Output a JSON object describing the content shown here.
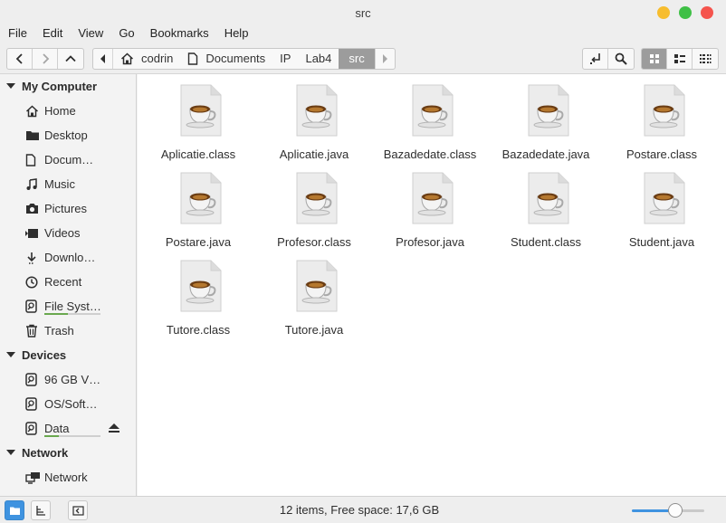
{
  "window": {
    "title": "src"
  },
  "menu": [
    "File",
    "Edit",
    "View",
    "Go",
    "Bookmarks",
    "Help"
  ],
  "breadcrumbs": [
    {
      "label": "codrin",
      "icon": "home-icon"
    },
    {
      "label": "Documents",
      "icon": "document-icon"
    },
    {
      "label": "IP"
    },
    {
      "label": "Lab4"
    },
    {
      "label": "src",
      "active": true
    }
  ],
  "sidebar": {
    "sections": [
      {
        "title": "My Computer",
        "items": [
          {
            "label": "Home",
            "icon": "home-icon"
          },
          {
            "label": "Desktop",
            "icon": "folder-icon"
          },
          {
            "label": "Docum…",
            "icon": "document-icon"
          },
          {
            "label": "Music",
            "icon": "music-icon"
          },
          {
            "label": "Pictures",
            "icon": "camera-icon"
          },
          {
            "label": "Videos",
            "icon": "video-icon"
          },
          {
            "label": "Downlo…",
            "icon": "download-icon"
          },
          {
            "label": "Recent",
            "icon": "clock-icon"
          },
          {
            "label": "File Syst…",
            "icon": "drive-icon",
            "usage": 0.42
          },
          {
            "label": "Trash",
            "icon": "trash-icon"
          }
        ]
      },
      {
        "title": "Devices",
        "items": [
          {
            "label": "96 GB V…",
            "icon": "drive-icon"
          },
          {
            "label": "OS/Soft…",
            "icon": "drive-icon"
          },
          {
            "label": "Data",
            "icon": "drive-icon",
            "usage": 0.25,
            "eject": true
          }
        ]
      },
      {
        "title": "Network",
        "items": [
          {
            "label": "Network",
            "icon": "network-icon"
          }
        ]
      }
    ]
  },
  "files": [
    "Aplicatie.class",
    "Aplicatie.java",
    "Bazadedate.class",
    "Bazadedate.java",
    "Postare.class",
    "Postare.java",
    "Profesor.class",
    "Profesor.java",
    "Student.class",
    "Student.java",
    "Tutore.class",
    "Tutore.java"
  ],
  "status": {
    "text": "12 items, Free space: 17,6 GB",
    "zoom": 0.6
  },
  "colors": {
    "accent": "#3f93e0",
    "close": "#f5544d",
    "minimize": "#f7bd2e",
    "maximize": "#3fc046"
  }
}
